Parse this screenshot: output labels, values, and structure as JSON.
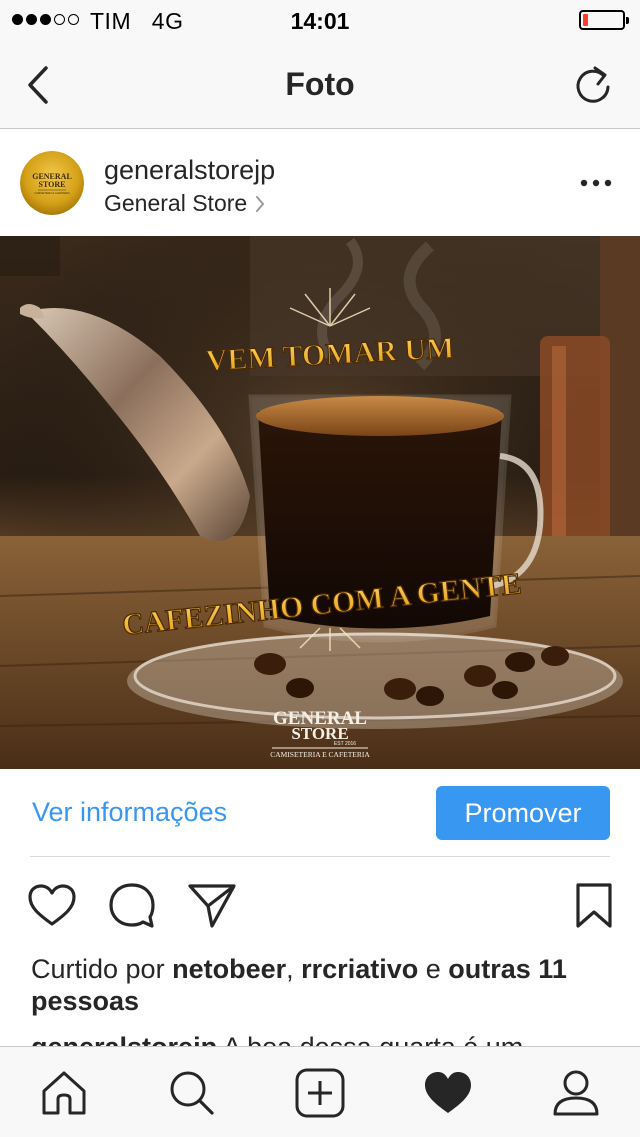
{
  "status_bar": {
    "carrier": "TIM",
    "network": "4G",
    "time": "14:01",
    "signal_bars_filled": 3,
    "signal_bars_total": 5,
    "battery_level_percent": 10,
    "battery_color": "#ff3b30"
  },
  "nav": {
    "title": "Foto",
    "back_icon": "chevron-left-icon",
    "refresh_icon": "refresh-icon"
  },
  "post": {
    "username": "generalstorejp",
    "location": "General Store",
    "more_icon": "more-horizontal-icon",
    "avatar_logo": {
      "line1": "GENERAL",
      "line2": "STORE",
      "line3": "CAMISETERIA E CAFETERIA"
    },
    "photo": {
      "headline_top": "VEM TOMAR UM",
      "headline_bottom": "CAFEZINHO COM A GENTE",
      "logo_line1": "GENERAL",
      "logo_line2": "STORE",
      "logo_est": "EST 2016",
      "logo_subtitle": "CAMISETERIA E CAFETERIA"
    }
  },
  "insights": {
    "info_label": "Ver informações",
    "promote_label": "Promover",
    "accent_color": "#3897f0"
  },
  "actions": {
    "like_icon": "heart-outline-icon",
    "comment_icon": "comment-icon",
    "share_icon": "paper-plane-icon",
    "save_icon": "bookmark-icon"
  },
  "likes": {
    "prefix": "Curtido por",
    "user1": "netobeer",
    "separator": ",",
    "user2": "rrcriativo",
    "conjunction": "e",
    "others": "outras 11 pessoas"
  },
  "caption": {
    "username": "generalstorejp",
    "text": "A boa dessa quarta é um"
  },
  "tab_bar": {
    "items": [
      {
        "name": "home",
        "icon": "home-icon"
      },
      {
        "name": "search",
        "icon": "search-icon"
      },
      {
        "name": "new-post",
        "icon": "plus-square-icon"
      },
      {
        "name": "activity",
        "icon": "heart-filled-icon"
      },
      {
        "name": "profile",
        "icon": "profile-icon"
      }
    ]
  }
}
